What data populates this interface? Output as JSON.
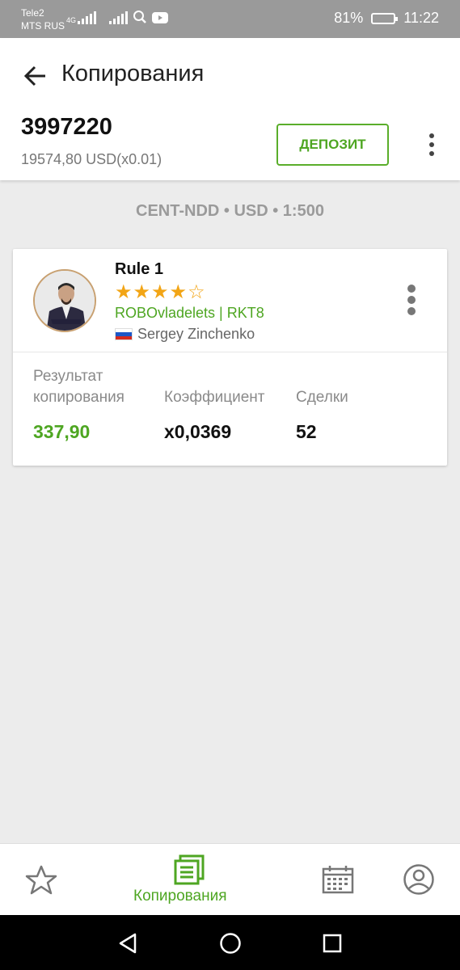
{
  "status_bar": {
    "carrier_1": "Tele2",
    "carrier_2": "MTS RUS",
    "network": "4G",
    "battery": "81%",
    "time": "11:22"
  },
  "header": {
    "title": "Копирования",
    "account_number": "3997220",
    "balance": "19574,80 USD(x0.01)",
    "deposit_label": "ДЕПОЗИТ"
  },
  "account_meta": "CENT-NDD • USD • 1:500",
  "card": {
    "strategy_name": "Rule 1",
    "rating": {
      "value": 4,
      "max": 5,
      "display": "★★★★☆"
    },
    "strategy_sub": "ROBOvladelets | RKT8",
    "trader_name": "Sergey Zinchenko",
    "stats": [
      {
        "label_line1": "Результат",
        "label_line2": "копирования",
        "value": "337,90"
      },
      {
        "label_line1": "",
        "label_line2": "Коэффициент",
        "value": "x0,0369"
      },
      {
        "label_line1": "",
        "label_line2": "Сделки",
        "value": "52"
      }
    ]
  },
  "bottom_nav": {
    "active_label": "Копирования",
    "items": [
      "star-icon",
      "copy-icon",
      "calendar-icon",
      "profile-icon"
    ]
  },
  "colors": {
    "accent": "#4ea622",
    "star": "#f2a516",
    "status_bar": "#9a9a9a",
    "background": "#ececec"
  }
}
